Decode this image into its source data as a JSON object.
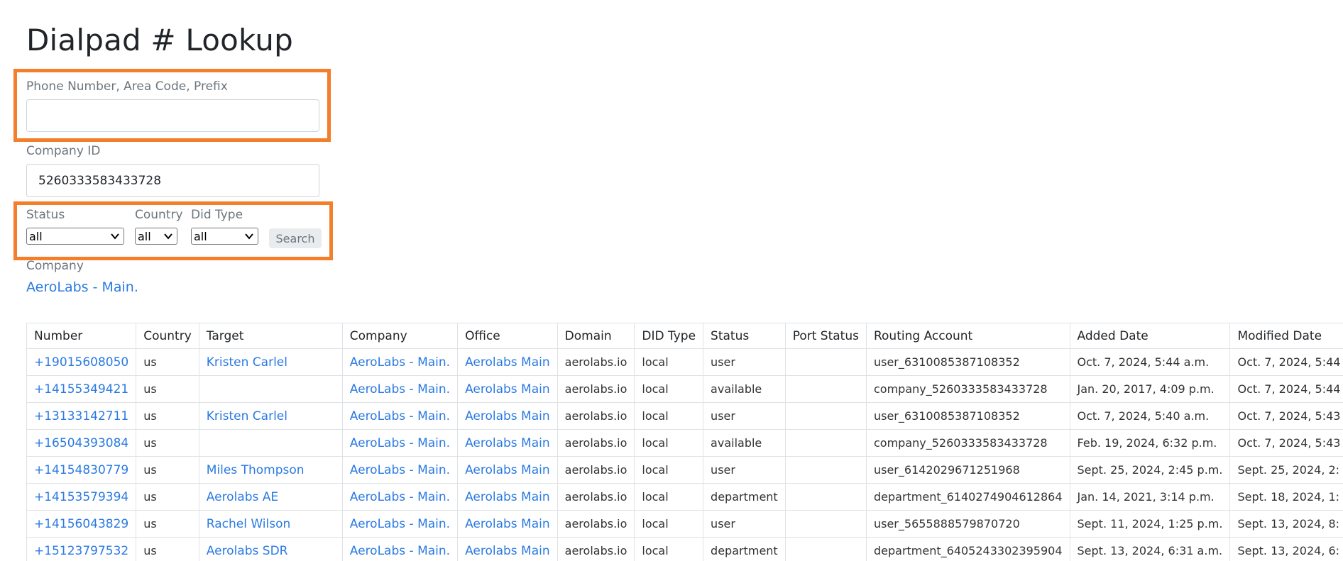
{
  "page": {
    "title": "Dialpad # Lookup"
  },
  "form": {
    "phone_label": "Phone Number, Area Code, Prefix",
    "phone_value": "",
    "company_id_label": "Company ID",
    "company_id_value": "5260333583433728",
    "status_label": "Status",
    "status_value": "all",
    "country_label": "Country",
    "country_value": "all",
    "did_type_label": "Did Type",
    "did_type_value": "all",
    "search_label": "Search",
    "company_label": "Company",
    "company_link": "AeroLabs - Main."
  },
  "colors": {
    "highlight": "#f47e2a",
    "link": "#2a7ae2"
  },
  "table": {
    "headers": [
      "Number",
      "Country",
      "Target",
      "Company",
      "Office",
      "Domain",
      "DID Type",
      "Status",
      "Port Status",
      "Routing Account",
      "Added Date",
      "Modified Date"
    ],
    "rows": [
      {
        "number": "+19015608050",
        "country": "us",
        "target": "Kristen Carlel",
        "company": "AeroLabs - Main.",
        "office": "Aerolabs Main",
        "domain": "aerolabs.io",
        "did_type": "local",
        "status": "user",
        "port_status": "",
        "routing": "user_6310085387108352",
        "added": "Oct. 7, 2024, 5:44 a.m.",
        "modified": "Oct. 7, 2024, 5:44"
      },
      {
        "number": "+14155349421",
        "country": "us",
        "target": "",
        "company": "AeroLabs - Main.",
        "office": "Aerolabs Main",
        "domain": "aerolabs.io",
        "did_type": "local",
        "status": "available",
        "port_status": "",
        "routing": "company_5260333583433728",
        "added": "Jan. 20, 2017, 4:09 p.m.",
        "modified": "Oct. 7, 2024, 5:44"
      },
      {
        "number": "+13133142711",
        "country": "us",
        "target": "Kristen Carlel",
        "company": "AeroLabs - Main.",
        "office": "Aerolabs Main",
        "domain": "aerolabs.io",
        "did_type": "local",
        "status": "user",
        "port_status": "",
        "routing": "user_6310085387108352",
        "added": "Oct. 7, 2024, 5:40 a.m.",
        "modified": "Oct. 7, 2024, 5:43"
      },
      {
        "number": "+16504393084",
        "country": "us",
        "target": "",
        "company": "AeroLabs - Main.",
        "office": "Aerolabs Main",
        "domain": "aerolabs.io",
        "did_type": "local",
        "status": "available",
        "port_status": "",
        "routing": "company_5260333583433728",
        "added": "Feb. 19, 2024, 6:32 p.m.",
        "modified": "Oct. 7, 2024, 5:43"
      },
      {
        "number": "+14154830779",
        "country": "us",
        "target": "Miles Thompson",
        "company": "AeroLabs - Main.",
        "office": "Aerolabs Main",
        "domain": "aerolabs.io",
        "did_type": "local",
        "status": "user",
        "port_status": "",
        "routing": "user_6142029671251968",
        "added": "Sept. 25, 2024, 2:45 p.m.",
        "modified": "Sept. 25, 2024, 2:"
      },
      {
        "number": "+14153579394",
        "country": "us",
        "target": "Aerolabs AE",
        "company": "AeroLabs - Main.",
        "office": "Aerolabs Main",
        "domain": "aerolabs.io",
        "did_type": "local",
        "status": "department",
        "port_status": "",
        "routing": "department_6140274904612864",
        "added": "Jan. 14, 2021, 3:14 p.m.",
        "modified": "Sept. 18, 2024, 1:"
      },
      {
        "number": "+14156043829",
        "country": "us",
        "target": "Rachel Wilson",
        "company": "AeroLabs - Main.",
        "office": "Aerolabs Main",
        "domain": "aerolabs.io",
        "did_type": "local",
        "status": "user",
        "port_status": "",
        "routing": "user_5655888579870720",
        "added": "Sept. 11, 2024, 1:25 p.m.",
        "modified": "Sept. 13, 2024, 8:"
      },
      {
        "number": "+15123797532",
        "country": "us",
        "target": "Aerolabs SDR",
        "company": "AeroLabs - Main.",
        "office": "Aerolabs Main",
        "domain": "aerolabs.io",
        "did_type": "local",
        "status": "department",
        "port_status": "",
        "routing": "department_6405243302395904",
        "added": "Sept. 13, 2024, 6:31 a.m.",
        "modified": "Sept. 13, 2024, 6:"
      }
    ]
  }
}
